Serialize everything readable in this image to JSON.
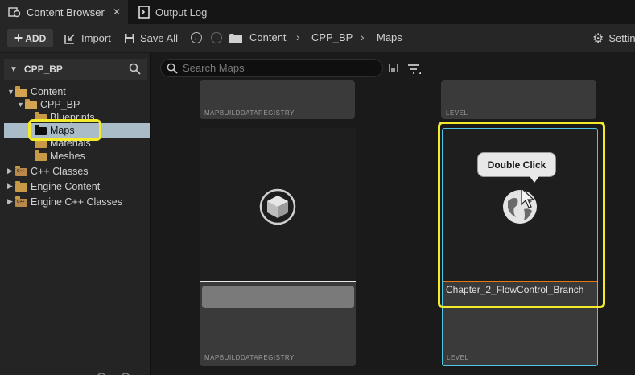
{
  "tabs": [
    {
      "label": "Content Browser",
      "icon": "content-browser-icon"
    },
    {
      "label": "Output Log",
      "icon": "output-log-icon"
    }
  ],
  "toolbar": {
    "add_label": "ADD",
    "import_label": "Import",
    "save_all_label": "Save All",
    "settings_label": "Settin",
    "breadcrumb": [
      "Content",
      "CPP_BP",
      "Maps"
    ]
  },
  "sidebar": {
    "root_title": "CPP_BP",
    "tree": [
      {
        "label": "Content",
        "level": 0,
        "expanded": true
      },
      {
        "label": "CPP_BP",
        "level": 1,
        "expanded": true
      },
      {
        "label": "Blueprints",
        "level": 2
      },
      {
        "label": "Maps",
        "level": 2,
        "selected": true
      },
      {
        "label": "Materials",
        "level": 2
      },
      {
        "label": "Meshes",
        "level": 2
      },
      {
        "label": "C++ Classes",
        "level": 0,
        "expanded": false
      },
      {
        "label": "Engine Content",
        "level": 0,
        "expanded": false
      },
      {
        "label": "Engine C++ Classes",
        "level": 0,
        "expanded": false
      }
    ]
  },
  "search": {
    "placeholder": "Search Maps"
  },
  "assets": {
    "top_left_type": "MAPBUILDDATAREGISTRY",
    "top_right_type": "LEVEL",
    "card1_type": "MAPBUILDDATAREGISTRY",
    "card2_name": "Chapter_2_FlowControl_Branch",
    "card2_type": "LEVEL"
  },
  "annotation": {
    "tooltip": "Double Click"
  },
  "colors": {
    "highlight": "#f2ea2b",
    "selection": "#4fc6e6",
    "level_accent": "#e07a10",
    "folder": "#c99a46"
  }
}
